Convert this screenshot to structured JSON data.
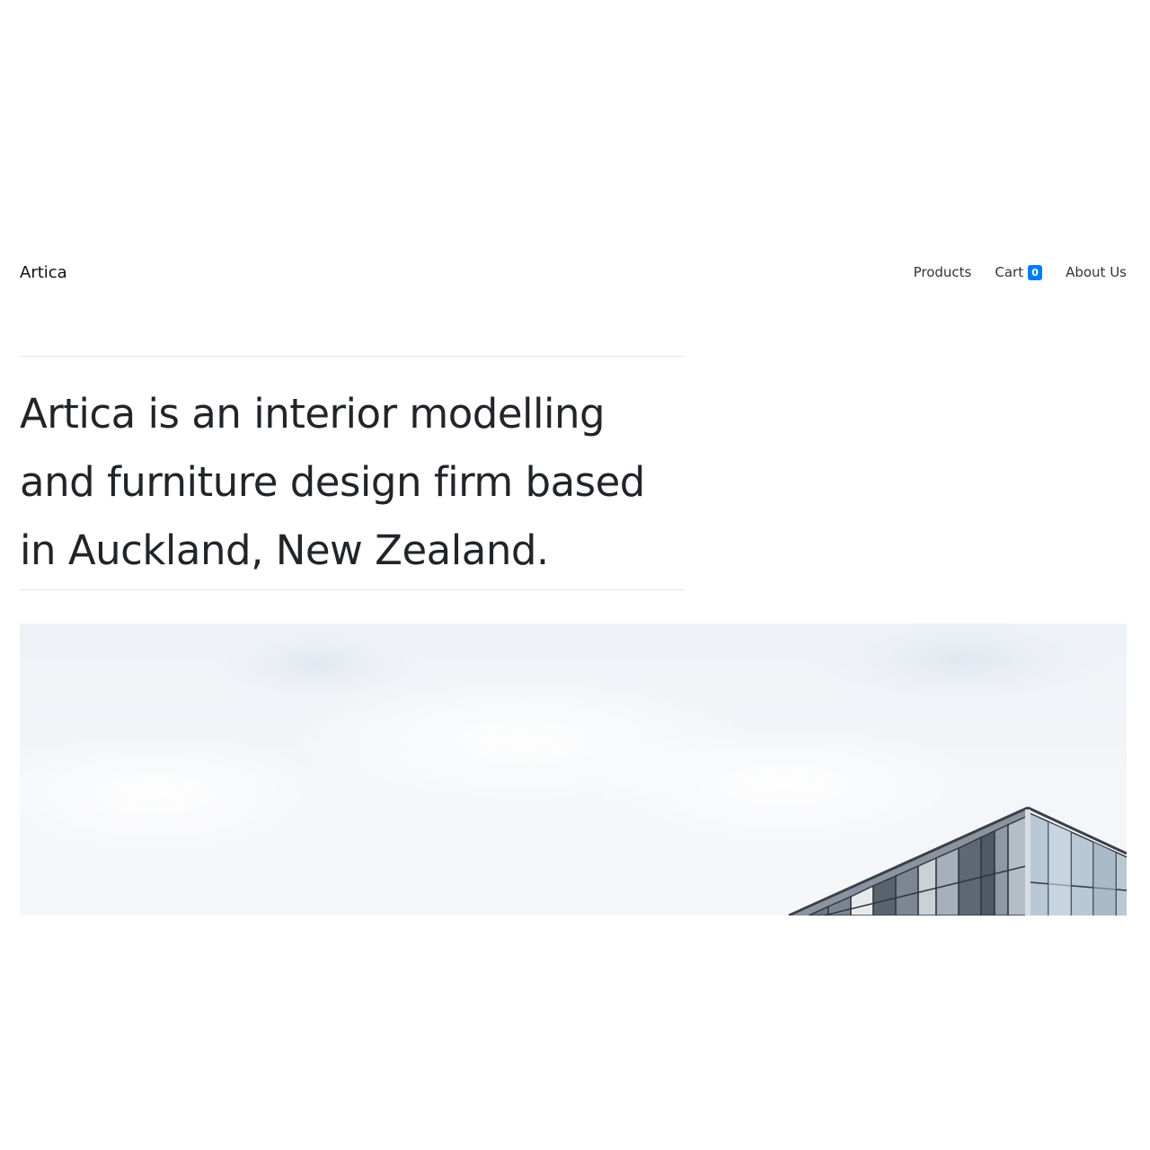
{
  "navbar": {
    "brand": "Artica",
    "links": [
      {
        "label": "Products"
      },
      {
        "label": "Cart",
        "badge": "0"
      },
      {
        "label": "About Us"
      }
    ]
  },
  "intro": {
    "text": "Artica is an interior modelling and furniture design firm based in Auckland, New Zealand."
  },
  "hero_image": {
    "alt": "Modern glass office building against a cloudy sky"
  },
  "colors": {
    "accent": "#007bff",
    "text": "#212529",
    "divider": "#e3e5e8"
  }
}
